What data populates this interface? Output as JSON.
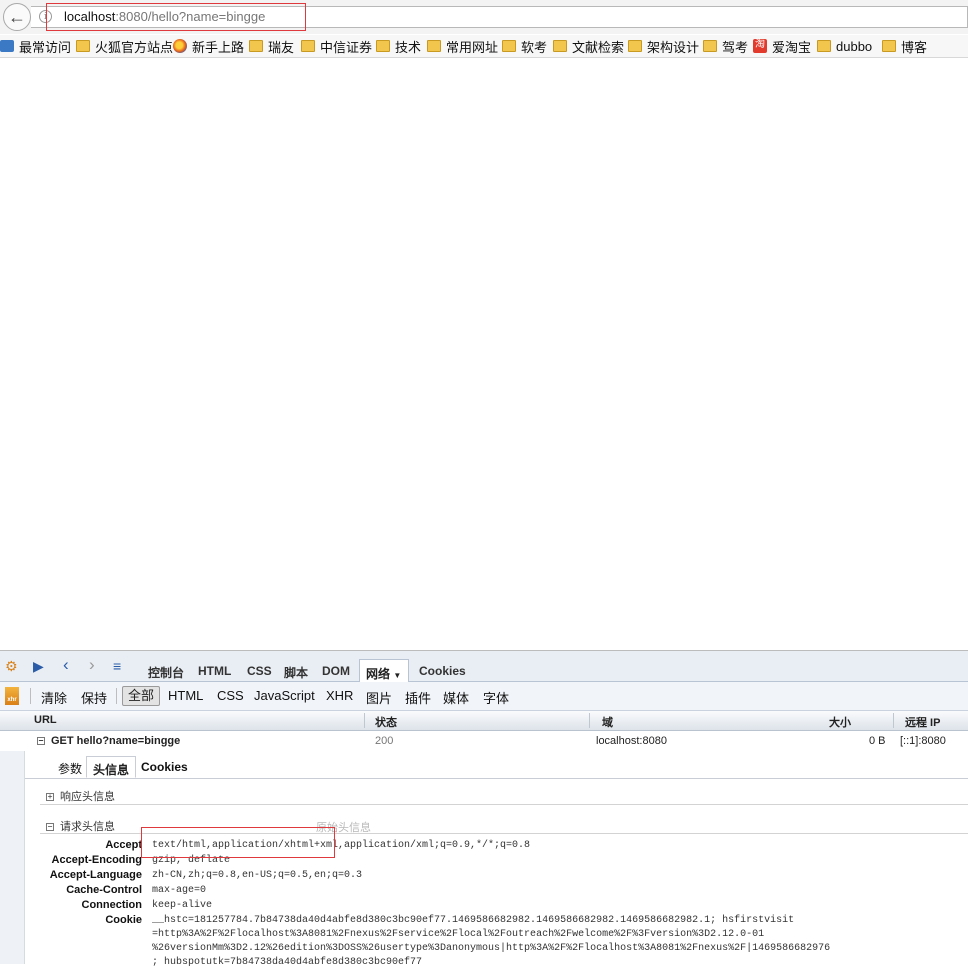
{
  "address_bar": {
    "url_host": "localhost",
    "url_rest": ":8080/hello?name=bingge"
  },
  "bookmarks": [
    {
      "label": "最常访问",
      "icon": "search-icon"
    },
    {
      "label": "火狐官方站点",
      "icon": "folder-icon"
    },
    {
      "label": "新手上路",
      "icon": "firefox-icon"
    },
    {
      "label": "瑞友",
      "icon": "folder-icon"
    },
    {
      "label": "中信证券",
      "icon": "folder-icon"
    },
    {
      "label": "技术",
      "icon": "folder-icon"
    },
    {
      "label": "常用网址",
      "icon": "folder-icon"
    },
    {
      "label": "软考",
      "icon": "folder-icon"
    },
    {
      "label": "文献检索",
      "icon": "folder-icon"
    },
    {
      "label": "架构设计",
      "icon": "folder-icon"
    },
    {
      "label": "驾考",
      "icon": "folder-icon"
    },
    {
      "label": "爱淘宝",
      "icon": "taobao-icon",
      "icon_text": "淘"
    },
    {
      "label": "dubbo",
      "icon": "folder-icon"
    },
    {
      "label": "博客",
      "icon": "folder-icon"
    }
  ],
  "devtools": {
    "tabs": [
      "控制台",
      "HTML",
      "CSS",
      "脚本",
      "DOM",
      "网络",
      "Cookies"
    ],
    "active_tab": "网络",
    "net_toolbar": {
      "clear": "清除",
      "persist": "保持",
      "filters": [
        "全部",
        "HTML",
        "CSS",
        "JavaScript",
        "XHR",
        "图片",
        "插件",
        "媒体",
        "字体"
      ],
      "xhr_icon_text": "xhr"
    },
    "columns": [
      "URL",
      "状态",
      "域",
      "大小",
      "远程 IP"
    ],
    "request": {
      "method_url": "GET hello?name=bingge",
      "status": "200",
      "domain": "localhost:8080",
      "size": "0 B",
      "remote_ip": "[::1]:8080"
    },
    "detail_tabs": [
      "参数",
      "头信息",
      "Cookies"
    ],
    "response_headers_title": "响应头信息",
    "request_headers_title": "请求头信息",
    "raw_headers_link": "原始头信息",
    "request_headers": [
      {
        "key": "Accept",
        "value": "text/html,application/xhtml+xml,application/xml;q=0.9,*/*;q=0.8"
      },
      {
        "key": "Accept-Encoding",
        "value": "gzip, deflate"
      },
      {
        "key": "Accept-Language",
        "value": "zh-CN,zh;q=0.8,en-US;q=0.5,en;q=0.3"
      },
      {
        "key": "Cache-Control",
        "value": "max-age=0"
      },
      {
        "key": "Connection",
        "value": "keep-alive"
      },
      {
        "key": "Cookie",
        "value": "__hstc=181257784.7b84738da40d4abfe8d380c3bc90ef77.1469586682982.1469586682982.1469586682982.1; hsfirstvisit"
      }
    ],
    "cookie_continuation": [
      "=http%3A%2F%2Flocalhost%3A8081%2Fnexus%2Fservice%2Flocal%2Foutreach%2Fwelcome%2F%3Fversion%3D2.12.0-01",
      "%26versionMm%3D2.12%26edition%3DOSS%26usertype%3Danonymous|http%3A%2F%2Flocalhost%3A8081%2Fnexus%2F|1469586682976",
      "; hubspotutk=7b84738da40d4abfe8d380c3bc90ef77"
    ]
  }
}
